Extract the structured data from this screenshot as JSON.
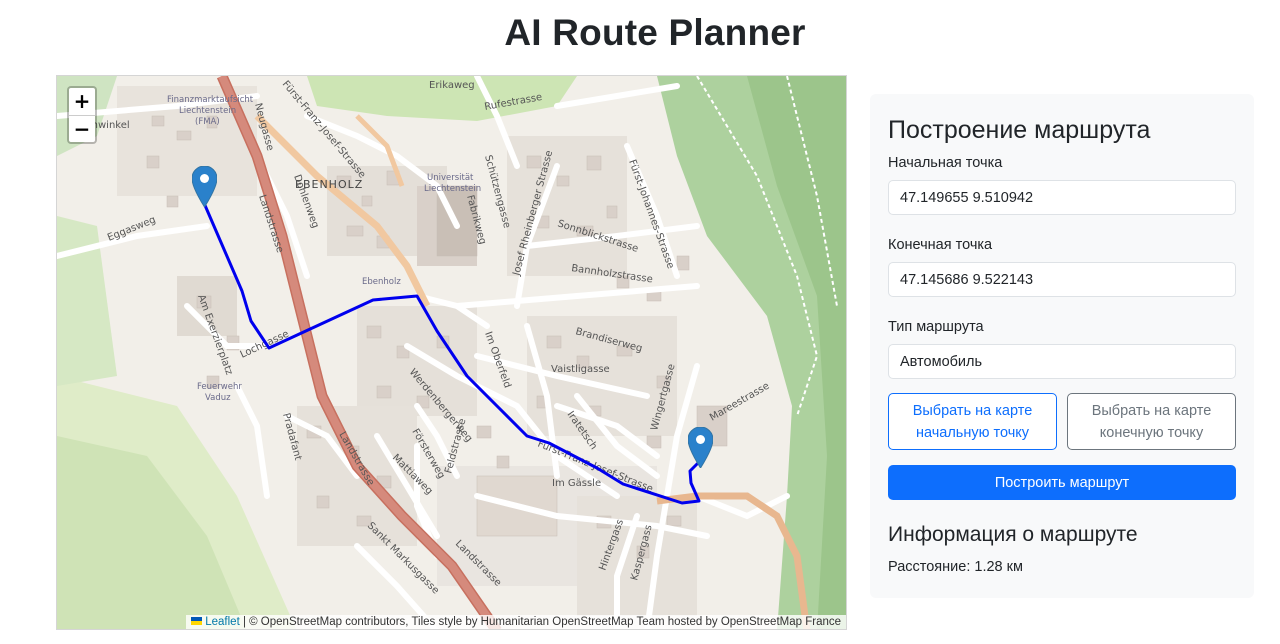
{
  "page": {
    "title": "AI Route Planner"
  },
  "map": {
    "zoom_in": "+",
    "zoom_out": "−",
    "labels": {
      "rehwinkel": "Rehwinkel",
      "fma_1": "Finanzmarktaufsicht",
      "fma_2": "Liechtenstein",
      "fma_3": "(FMA)",
      "erikaweg": "Erikaweg",
      "rufestrasse": "Rufestrasse",
      "fuerst_franz_josef": "Fürst-Franz-Josef-Strasse",
      "neugasse": "Neugasse",
      "ebenholz": "EBENHOLZ",
      "uni_1": "Universität",
      "uni_2": "Liechtenstein",
      "fabrikweg": "Fabrikweg",
      "schuetzengasse": "Schützengasse",
      "josef_rheinberger": "Josef Rheinberger Strasse",
      "sonnblickstrasse": "Sonnblickstrasse",
      "fuerst_johannes": "Fürst-Johannes-Strasse",
      "dohlenweg": "Dohlenweg",
      "landstrasse_top": "Landstrasse",
      "eggasweg": "Eggasweg",
      "ebenholz_stop": "Ebenholz",
      "bannholzstrasse": "Bannholzstrasse",
      "am_exerzierplatz": "Am Exerzierplatz",
      "brandiserweg": "Brandiserweg",
      "im_oberfeld": "Im Oberfeld",
      "vaistligasse": "Vaistligasse",
      "lochgasse": "Lochgasse",
      "feuerwehr_1": "Feuerwehr",
      "feuerwehr_2": "Vaduz",
      "werdenbergerweg": "Werdenbergerweg",
      "iratetsch": "Iratetsch",
      "wingertgasse": "Wingertgasse",
      "mareestrasse": "Mareestrasse",
      "pradafant": "Pradafant",
      "landstrasse_mid": "Landstrasse",
      "foersterweg": "Försterweg",
      "mattiaweg": "Mattiaweg",
      "feldstrasse": "Feldstrasse",
      "fuerst_franz_josef_2": "Fürst-Franz-Josef-Strasse",
      "im_gassle": "Im Gässle",
      "hintergass": "Hintergass",
      "kaspergass": "Kaspergass",
      "sankt_markusgasse": "Sankt Markusgasse",
      "landstrasse_bottom": "Landstrasse"
    },
    "attribution": {
      "leaflet": "Leaflet",
      "text": " | © OpenStreetMap contributors, Tiles style by Humanitarian OpenStreetMap Team hosted by OpenStreetMap France"
    },
    "colors": {
      "route": "#0000ee",
      "marker": "#2a81cb",
      "main_road": "#d58a7c"
    }
  },
  "form": {
    "title": "Построение маршрута",
    "start_label": "Начальная точка",
    "start_value": "47.149655 9.510942",
    "end_label": "Конечная точка",
    "end_value": "47.145686 9.522143",
    "route_type_label": "Тип маршрута",
    "route_type_value": "Автомобиль",
    "pick_start_line1": "Выбрать на карте",
    "pick_start_line2": "начальную точку",
    "pick_end_line1": "Выбрать на карте",
    "pick_end_line2": "конечную точку",
    "build_button": "Построить маршрут"
  },
  "info": {
    "title": "Информация о маршруте",
    "distance": "Расстояние: 1.28 км"
  }
}
